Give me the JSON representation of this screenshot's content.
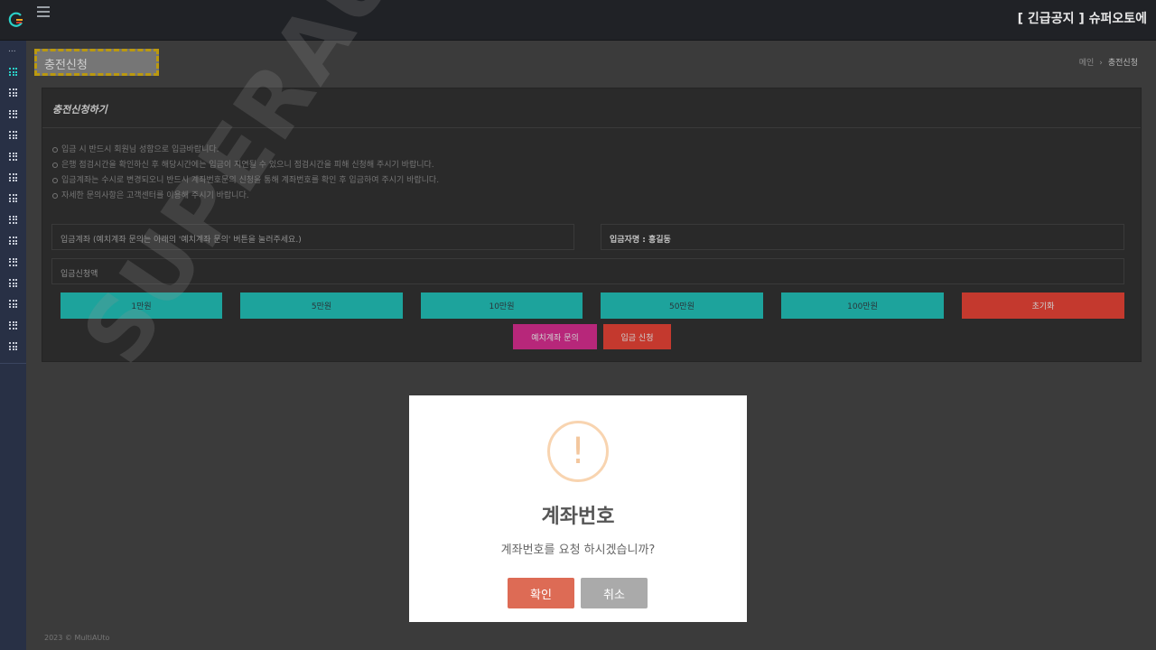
{
  "topbar": {
    "notice": "[ 긴급공지 ] 슈퍼오토에"
  },
  "sidebar": {
    "dots": "...",
    "item_count": 14
  },
  "main": {
    "page_title": "충전신청",
    "breadcrumb": {
      "home": "메인",
      "separator": "›",
      "current": "충전신청"
    }
  },
  "card": {
    "title": "충전신청하기",
    "notices": [
      "입금 시 반드시 회원님 성함으로 입금바랍니다.",
      "은행 점검시간을 확인하신 후 해당시간에는 입금이 지연될 수 있으니 점검시간을 피해 신청해 주시기 바랍니다.",
      "입금계좌는 수시로 변경되오니 반드시 계좌번호문의 신청을 통해 계좌번호를 확인 후 입금하여 주시기 바랍니다.",
      "자세한 문의사항은 고객센터를 이용해 주시기 바랍니다."
    ],
    "account_field": "입금계좌 (예치계좌 문의는 아래의 '예치계좌 문의' 버튼을 눌러주세요.)",
    "depositor_field": "입금자명 : 홍길동",
    "amount_field": "입금신청액",
    "amount_buttons": [
      "1만원",
      "5만원",
      "10만원",
      "50만원",
      "100만원"
    ],
    "reset_button": "초기화",
    "inquiry_button": "예치계좌 문의",
    "submit_button": "입금 신청"
  },
  "footer": "2023 © MultiAUto",
  "watermark": "SUPERAUTO",
  "modal": {
    "icon": "!",
    "title": "계좌번호",
    "message": "계좌번호를 요청 하시겠습니까?",
    "confirm": "확인",
    "cancel": "취소"
  },
  "colors": {
    "teal": "#13c6bd",
    "red": "#f2392a",
    "magenta": "#e0208f",
    "confirm": "#dd6b55",
    "cancel": "#aaaaaa",
    "highlight": "#e6b800"
  }
}
